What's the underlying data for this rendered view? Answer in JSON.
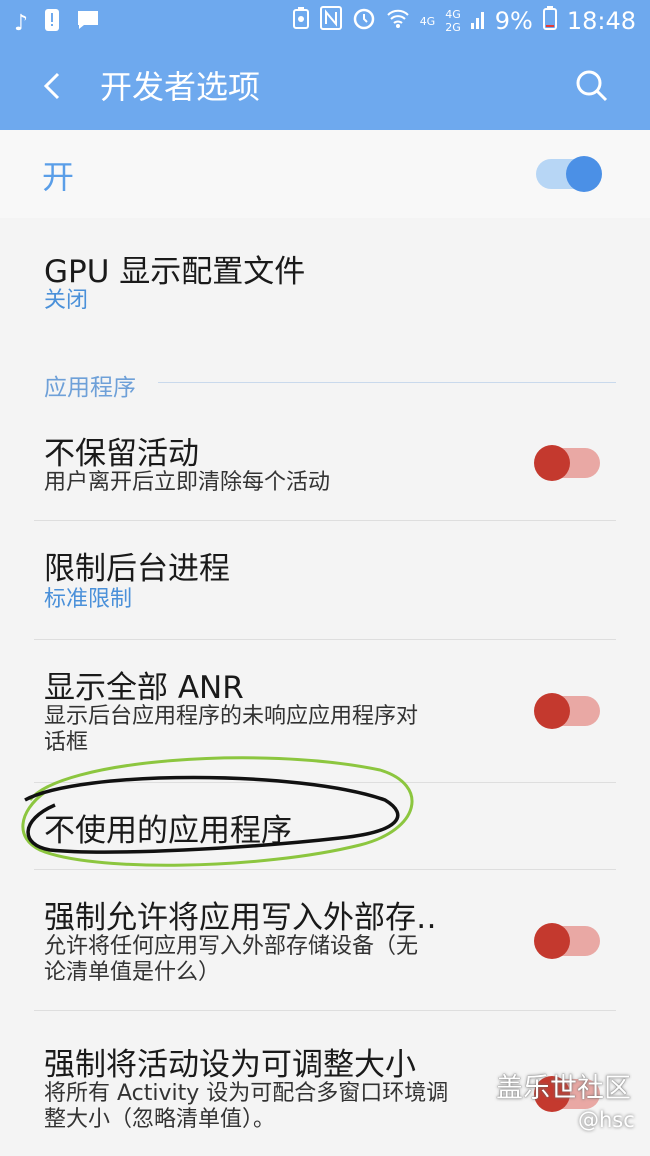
{
  "status_bar": {
    "network_left": "4G",
    "network_right_top": "4G",
    "network_right_bottom": "2G",
    "battery_percent": "9%",
    "time": "18:48",
    "icons": [
      "music-note-icon",
      "alert-icon",
      "message-icon",
      "battery-saver-icon",
      "nfc-icon",
      "alarm-icon",
      "wifi-icon",
      "signal-icon",
      "battery-icon"
    ]
  },
  "app_bar": {
    "title": "开发者选项",
    "back_icon": "back-arrow-icon",
    "search_icon": "search-icon"
  },
  "master_switch": {
    "label": "开",
    "on": true,
    "color": "#4b90e6"
  },
  "items": {
    "gpu": {
      "title": "GPU 显示配置文件",
      "value": "关闭"
    },
    "section_header": "应用程序",
    "dont_keep": {
      "title": "不保留活动",
      "summary": "用户离开后立即清除每个活动",
      "on": false
    },
    "bg_limit": {
      "title": "限制后台进程",
      "value": "标准限制"
    },
    "show_anr": {
      "title": "显示全部 ANR",
      "summary_line1": "显示后台应用程序的未响应应用程序对",
      "summary_line2": "话框",
      "on": false
    },
    "inactive_apps": {
      "title": "不使用的应用程序"
    },
    "force_external": {
      "title": "强制允许将应用写入外部存‥",
      "summary_line1": "允许将任何应用写入外部存储设备（无",
      "summary_line2": "论清单值是什么）",
      "on": false
    },
    "force_resizable": {
      "title": "强制将活动设为可调整大小",
      "summary_line1": "将所有 Activity 设为可配合多窗口环境调",
      "summary_line2": "整大小（忽略清单值）。",
      "on": false
    }
  },
  "watermark": {
    "site": "盖乐世社区",
    "user": "@hsc"
  },
  "colors": {
    "accent": "#6ea9ee",
    "toggle_off_red": "#c4392e",
    "highlight_circle": "#8cc63f"
  }
}
